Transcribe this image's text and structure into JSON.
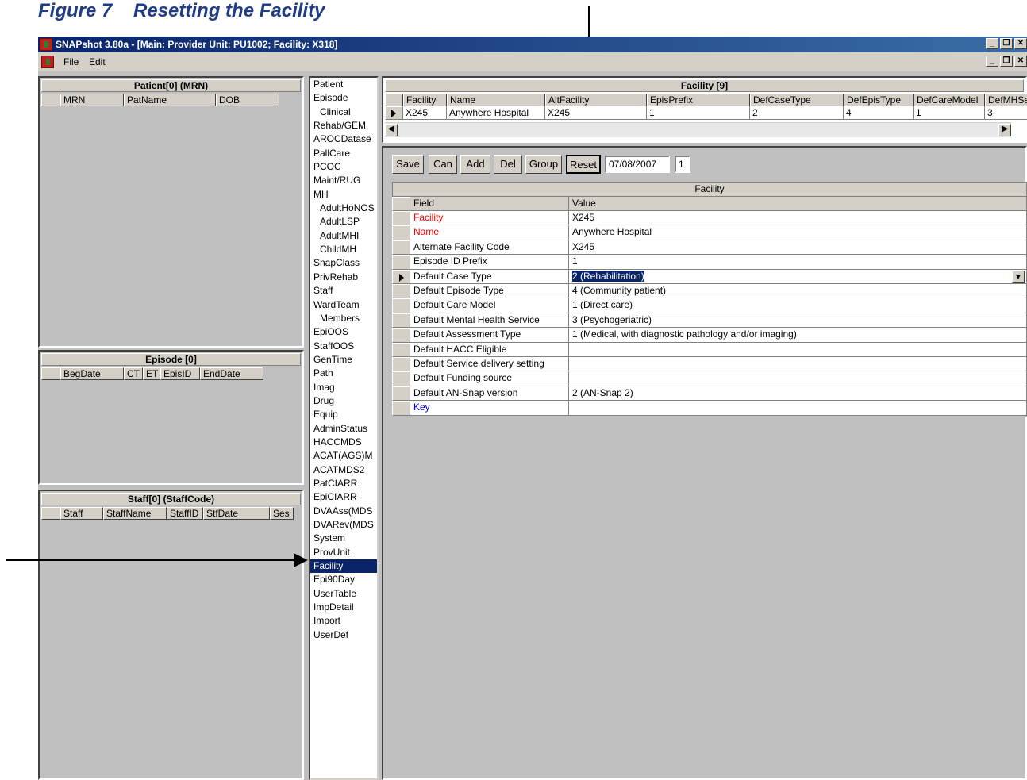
{
  "figure": {
    "title": "Figure 7    Resetting the Facility"
  },
  "window": {
    "title": "SNAPshot 3.80a - [Main: Provider Unit: PU1002; Facility: X318]"
  },
  "menu": {
    "file": "File",
    "edit": "Edit"
  },
  "patient_panel": {
    "header": "Patient[0] (MRN)",
    "columns": [
      "MRN",
      "PatName",
      "DOB"
    ]
  },
  "episode_panel": {
    "header": "Episode [0]",
    "columns": [
      "BegDate",
      "CT",
      "ET",
      "EpisID",
      "EndDate"
    ]
  },
  "staff_panel": {
    "header": "Staff[0] (StaffCode)",
    "columns": [
      "Staff",
      "StaffName",
      "StaffID",
      "StfDate",
      "Ses"
    ]
  },
  "nav": {
    "items": [
      "Patient",
      "Episode",
      "Clinical",
      "Rehab/GEM",
      "AROCDatase",
      "PallCare",
      "PCOC",
      "Maint/RUG",
      "MH",
      "AdultHoNOS",
      "AdultLSP",
      "AdultMHI",
      "ChildMH",
      "SnapClass",
      "PrivRehab",
      "Staff",
      "WardTeam",
      "Members",
      "EpiOOS",
      "StaffOOS",
      "GenTime",
      "Path",
      "Imag",
      "Drug",
      "Equip",
      "AdminStatus",
      "HACCMDS",
      "ACAT(AGS)M",
      "ACATMDS2",
      "PatCIARR",
      "EpiCIARR",
      "DVAAss(MDS",
      "DVARev(MDS",
      "System",
      "ProvUnit",
      "Facility",
      "Epi90Day",
      "UserTable",
      "ImpDetail",
      "Import",
      "UserDef"
    ],
    "selected": "Facility"
  },
  "facility_grid": {
    "header": "Facility [9]",
    "columns": [
      "Facility",
      "Name",
      "AltFacility",
      "EpisPrefix",
      "DefCaseType",
      "DefEpisType",
      "DefCareModel",
      "DefMHServ"
    ],
    "row": [
      "X245",
      "Anywhere Hospital",
      "X245",
      "1",
      "2",
      "4",
      "1",
      "3"
    ]
  },
  "toolbar": {
    "save": "Save",
    "can": "Can",
    "add": "Add",
    "del": "Del",
    "group": "Group",
    "reset": "Reset",
    "date": "07/08/2007",
    "num": "1"
  },
  "detail": {
    "header": "Facility",
    "col_field": "Field",
    "col_value": "Value",
    "rows": [
      {
        "field": "Facility",
        "value": "X245"
      },
      {
        "field": "Name",
        "value": "Anywhere Hospital"
      },
      {
        "field": "Alternate Facility Code",
        "value": "X245"
      },
      {
        "field": "Episode ID Prefix",
        "value": "1"
      },
      {
        "field": "Default Case Type",
        "value": "2 (Rehabilitation)"
      },
      {
        "field": "Default Episode Type",
        "value": "4 (Community patient)"
      },
      {
        "field": "Default Care Model",
        "value": "1 (Direct care)"
      },
      {
        "field": "Default Mental Health Service",
        "value": "3 (Psychogeriatric)"
      },
      {
        "field": "Default Assessment Type",
        "value": "1 (Medical, with diagnostic pathology and/or imaging)"
      },
      {
        "field": "Default HACC Eligible",
        "value": ""
      },
      {
        "field": "Default Service delivery setting",
        "value": ""
      },
      {
        "field": "Default Funding source",
        "value": ""
      },
      {
        "field": "Default AN-Snap version",
        "value": "2 (AN-Snap 2)"
      },
      {
        "field": "Key",
        "value": ""
      }
    ]
  },
  "colors": {
    "required_field": "#ff0000",
    "key_field": "#0000ff",
    "selection": "#0a246a"
  }
}
